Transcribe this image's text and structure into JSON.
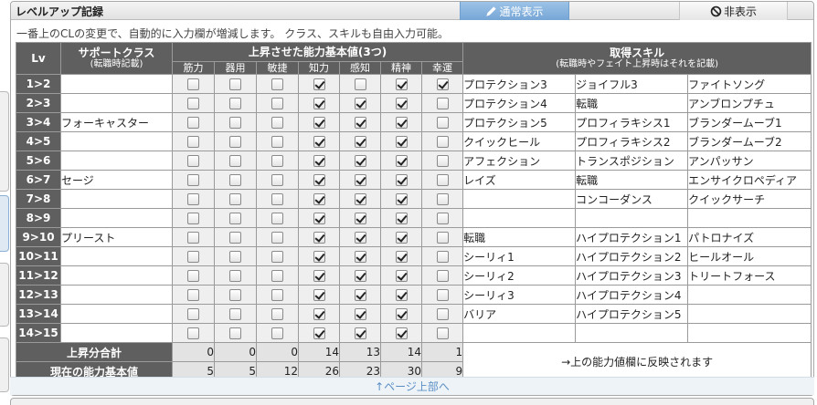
{
  "panel": {
    "title": "レベルアップ記録",
    "normal_view": "通常表示",
    "hide": "非表示",
    "note": "一番上のCLの変更で、自動的に入力欄が増減します。 クラス、スキルも自由入力可能。"
  },
  "headers": {
    "lv": "Lv",
    "support_class": "サポートクラス",
    "support_class_sub": "(転職時記載)",
    "abilities": "上昇させた能力基本値(3つ)",
    "ability_names": [
      "筋力",
      "器用",
      "敏捷",
      "知力",
      "感知",
      "精神",
      "幸運"
    ],
    "skills": "取得スキル",
    "skills_sub": "(転職時やフェイト上昇時はそれを記載)"
  },
  "rows": [
    {
      "lv": "1>2",
      "cls": "",
      "checks": [
        0,
        0,
        0,
        1,
        0,
        1,
        1
      ],
      "skills": [
        "プロテクション3",
        "ジョイフル3",
        "ファイトソング"
      ]
    },
    {
      "lv": "2>3",
      "cls": "",
      "checks": [
        0,
        0,
        0,
        1,
        1,
        1,
        0
      ],
      "skills": [
        "プロテクション4",
        "転職",
        "アンブロンプチュ"
      ]
    },
    {
      "lv": "3>4",
      "cls": "フォーキャスター",
      "checks": [
        0,
        0,
        0,
        1,
        1,
        1,
        0
      ],
      "skills": [
        "プロテクション5",
        "プロフィラキシス1",
        "ブランダームーブ1"
      ]
    },
    {
      "lv": "4>5",
      "cls": "",
      "checks": [
        0,
        0,
        0,
        1,
        1,
        1,
        0
      ],
      "skills": [
        "クイックヒール",
        "プロフィラキシス2",
        "ブランダームーブ2"
      ]
    },
    {
      "lv": "5>6",
      "cls": "",
      "checks": [
        0,
        0,
        0,
        1,
        1,
        1,
        0
      ],
      "skills": [
        "アフェクション",
        "トランスポジション",
        "アンパッサン"
      ]
    },
    {
      "lv": "6>7",
      "cls": "セージ",
      "checks": [
        0,
        0,
        0,
        1,
        1,
        1,
        0
      ],
      "skills": [
        "レイズ",
        "転職",
        "エンサイクロペディア"
      ]
    },
    {
      "lv": "7>8",
      "cls": "",
      "checks": [
        0,
        0,
        0,
        1,
        1,
        1,
        0
      ],
      "skills": [
        "",
        "コンコーダンス",
        "クイックサーチ"
      ]
    },
    {
      "lv": "8>9",
      "cls": "",
      "checks": [
        0,
        0,
        0,
        1,
        1,
        1,
        0
      ],
      "skills": [
        "",
        "",
        ""
      ]
    },
    {
      "lv": "9>10",
      "cls": "プリースト",
      "checks": [
        0,
        0,
        0,
        1,
        1,
        1,
        0
      ],
      "skills": [
        "転職",
        "ハイプロテクション1",
        "パトロナイズ"
      ]
    },
    {
      "lv": "10>11",
      "cls": "",
      "checks": [
        0,
        0,
        0,
        1,
        1,
        1,
        0
      ],
      "skills": [
        "シーリィ1",
        "ハイプロテクション2",
        "ヒールオール"
      ]
    },
    {
      "lv": "11>12",
      "cls": "",
      "checks": [
        0,
        0,
        0,
        1,
        1,
        1,
        0
      ],
      "skills": [
        "シーリィ2",
        "ハイプロテクション3",
        "トリートフォース"
      ]
    },
    {
      "lv": "12>13",
      "cls": "",
      "checks": [
        0,
        0,
        0,
        1,
        1,
        1,
        0
      ],
      "skills": [
        "シーリィ3",
        "ハイプロテクション4",
        ""
      ]
    },
    {
      "lv": "13>14",
      "cls": "",
      "checks": [
        0,
        0,
        0,
        1,
        1,
        1,
        0
      ],
      "skills": [
        "バリア",
        "ハイプロテクション5",
        ""
      ]
    },
    {
      "lv": "14>15",
      "cls": "",
      "checks": [
        0,
        0,
        0,
        1,
        1,
        1,
        0
      ],
      "skills": [
        "",
        "",
        ""
      ]
    }
  ],
  "totals": {
    "label": "上昇分合計",
    "values": [
      "0",
      "0",
      "0",
      "14",
      "13",
      "14",
      "1"
    ]
  },
  "current": {
    "label": "現在の能力基本値",
    "values": [
      "5",
      "5",
      "12",
      "26",
      "23",
      "30",
      "9"
    ]
  },
  "reflect_note": "→上の能力値欄に反映されます",
  "to_top": "↑ページ上部へ",
  "icons": {
    "normal_view": "pencil-icon",
    "hide": "no-entry-icon"
  },
  "colors": {
    "header_bg": "#5f5f5f",
    "accent_button": "#86b1dc",
    "link": "#5a8fc4"
  }
}
